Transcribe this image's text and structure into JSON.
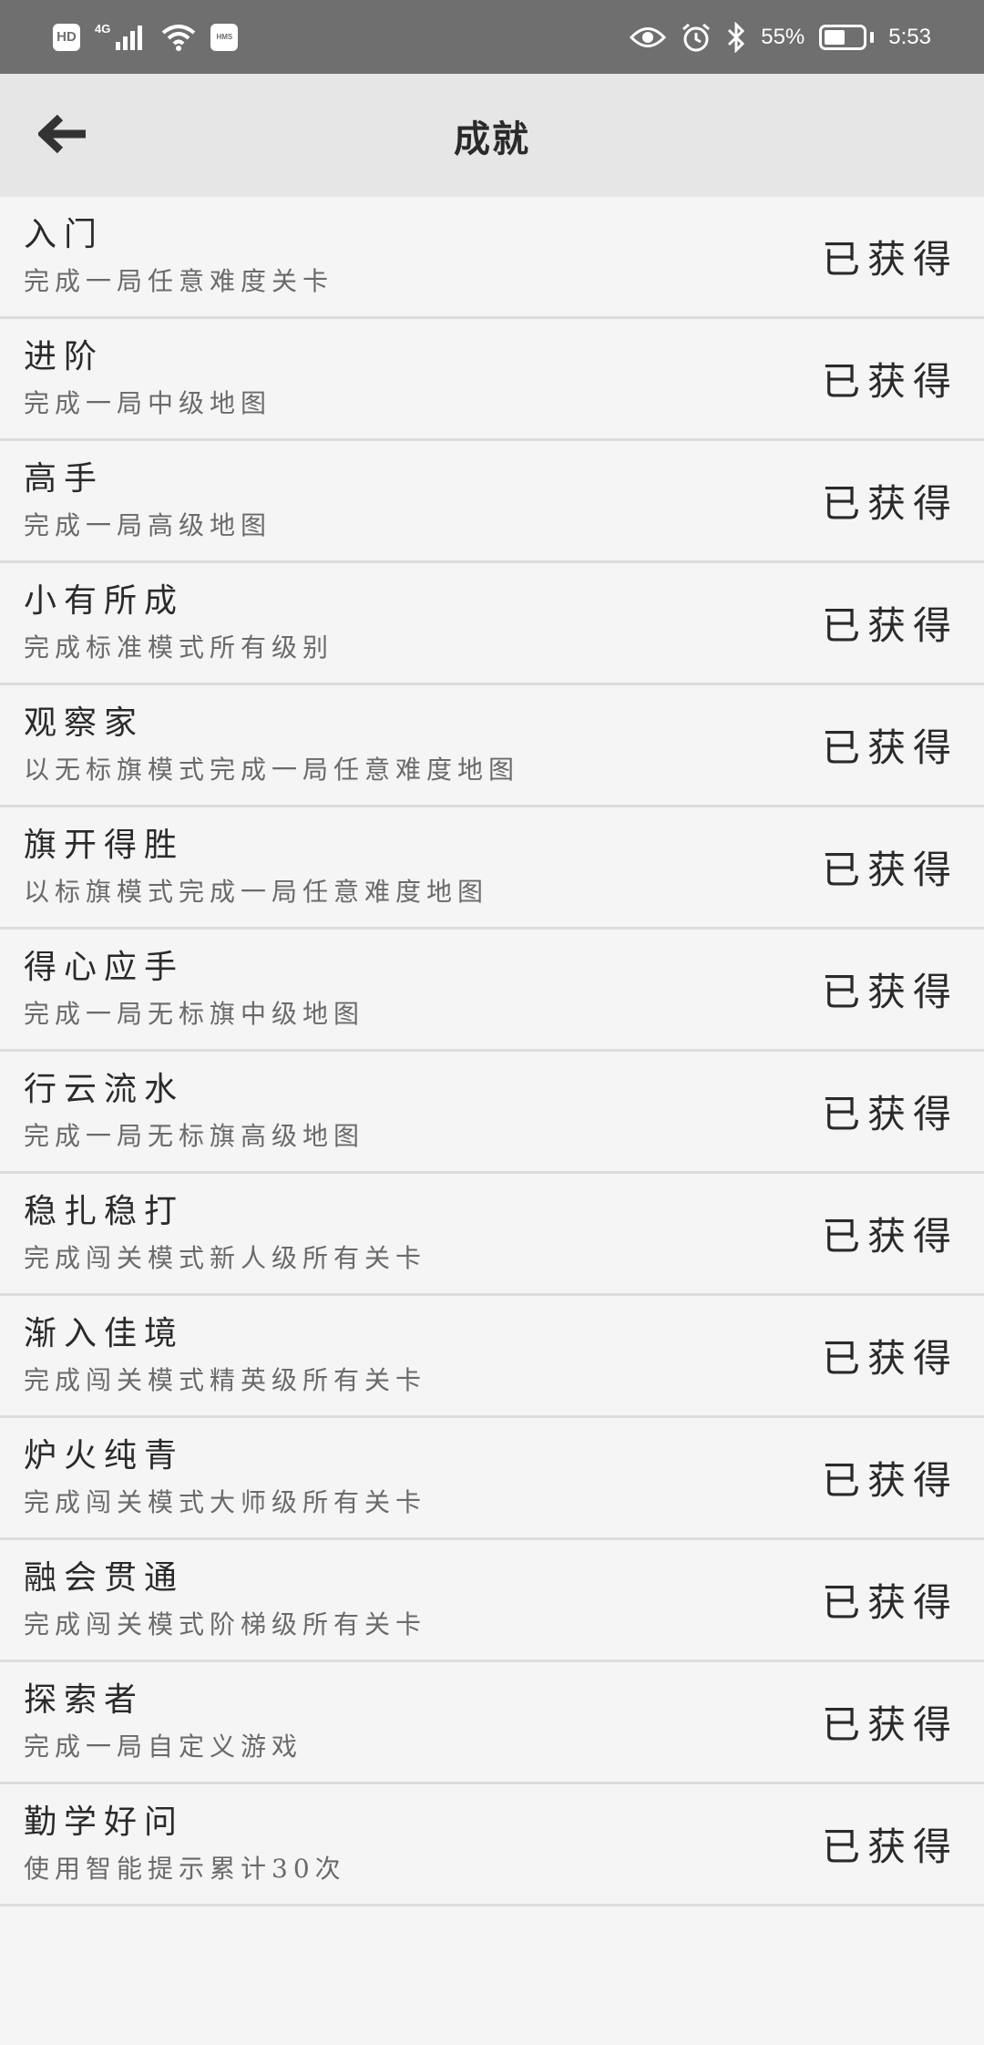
{
  "status_bar": {
    "left_badge": "HD",
    "network_tag": "4G",
    "hms_badge": "HMS",
    "battery_text": "55%",
    "time": "5:53",
    "icons": [
      "signal-icon",
      "wifi-icon",
      "eye-icon",
      "alarm-icon",
      "bluetooth-icon",
      "battery-icon"
    ],
    "battery_level": 0.55
  },
  "header": {
    "title": "成就",
    "back_icon": "back-arrow-icon"
  },
  "achievements": [
    {
      "title": "入门",
      "desc": "完成一局任意难度关卡",
      "status": "已获得"
    },
    {
      "title": "进阶",
      "desc": "完成一局中级地图",
      "status": "已获得"
    },
    {
      "title": "高手",
      "desc": "完成一局高级地图",
      "status": "已获得"
    },
    {
      "title": "小有所成",
      "desc": "完成标准模式所有级别",
      "status": "已获得"
    },
    {
      "title": "观察家",
      "desc": "以无标旗模式完成一局任意难度地图",
      "status": "已获得"
    },
    {
      "title": "旗开得胜",
      "desc": "以标旗模式完成一局任意难度地图",
      "status": "已获得"
    },
    {
      "title": "得心应手",
      "desc": "完成一局无标旗中级地图",
      "status": "已获得"
    },
    {
      "title": "行云流水",
      "desc": "完成一局无标旗高级地图",
      "status": "已获得"
    },
    {
      "title": "稳扎稳打",
      "desc": "完成闯关模式新人级所有关卡",
      "status": "已获得"
    },
    {
      "title": "渐入佳境",
      "desc": "完成闯关模式精英级所有关卡",
      "status": "已获得"
    },
    {
      "title": "炉火纯青",
      "desc": "完成闯关模式大师级所有关卡",
      "status": "已获得"
    },
    {
      "title": "融会贯通",
      "desc": "完成闯关模式阶梯级所有关卡",
      "status": "已获得"
    },
    {
      "title": "探索者",
      "desc": "完成一局自定义游戏",
      "status": "已获得"
    },
    {
      "title": "勤学好问",
      "desc": "使用智能提示累计30次",
      "status": "已获得"
    }
  ]
}
